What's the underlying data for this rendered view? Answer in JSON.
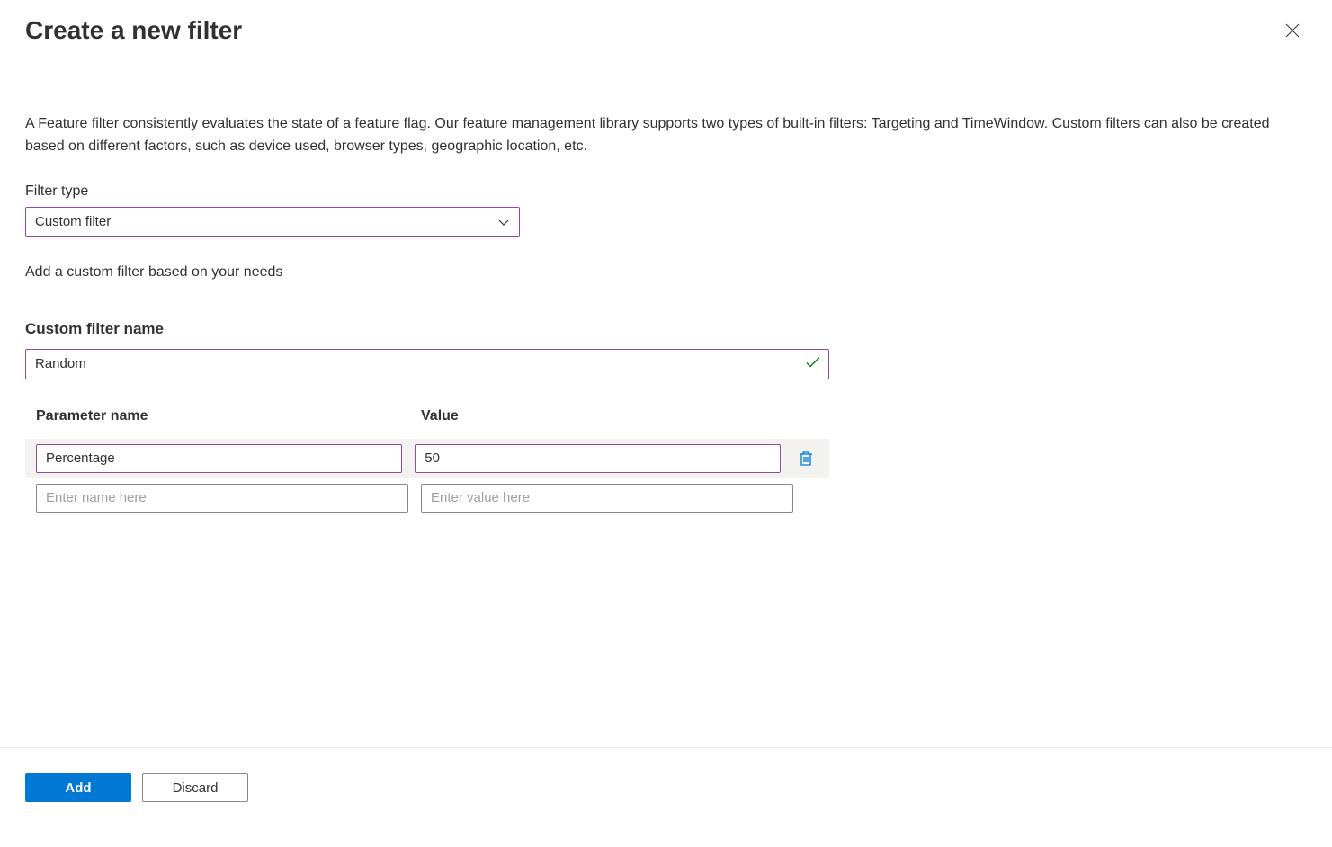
{
  "header": {
    "title": "Create a new filter"
  },
  "description": "A Feature filter consistently evaluates the state of a feature flag. Our feature management library supports two types of built-in filters: Targeting and TimeWindow. Custom filters can also be created based on different factors, such as device used, browser types, geographic location, etc.",
  "filterType": {
    "label": "Filter type",
    "value": "Custom filter"
  },
  "helper": "Add a custom filter based on your needs",
  "customName": {
    "label": "Custom filter name",
    "value": "Random"
  },
  "paramsHeader": {
    "name": "Parameter name",
    "value": "Value"
  },
  "params": {
    "row0": {
      "name": "Percentage",
      "value": "50"
    },
    "placeholders": {
      "name": "Enter name here",
      "value": "Enter value here"
    }
  },
  "footer": {
    "add": "Add",
    "discard": "Discard"
  }
}
